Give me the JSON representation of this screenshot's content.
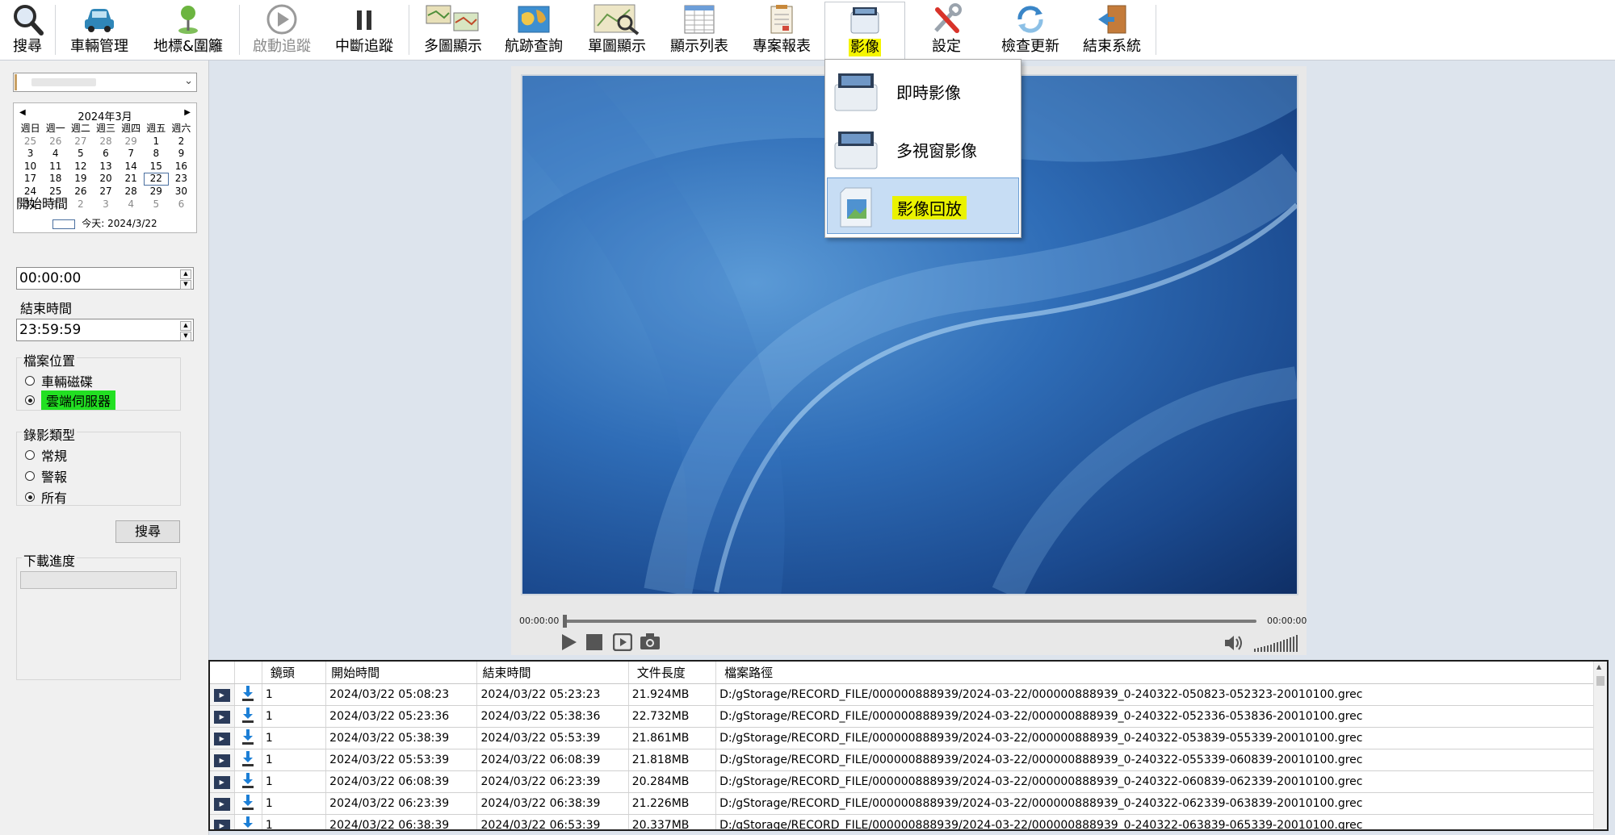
{
  "toolbar": {
    "items": [
      {
        "id": "search",
        "label": "搜尋"
      },
      {
        "id": "vehicle",
        "label": "車輛管理"
      },
      {
        "id": "landmark",
        "label": "地標&圍籬"
      },
      {
        "id": "start_track",
        "label": "啟動追蹤",
        "disabled": true
      },
      {
        "id": "stop_track",
        "label": "中斷追蹤"
      },
      {
        "id": "multi_map",
        "label": "多圖顯示"
      },
      {
        "id": "track_query",
        "label": "航跡查詢"
      },
      {
        "id": "single_map",
        "label": "單圖顯示"
      },
      {
        "id": "list",
        "label": "顯示列表"
      },
      {
        "id": "report",
        "label": "專案報表"
      },
      {
        "id": "video",
        "label": "影像",
        "active": true
      },
      {
        "id": "settings",
        "label": "設定"
      },
      {
        "id": "update",
        "label": "檢查更新"
      },
      {
        "id": "exit",
        "label": "結束系統"
      }
    ]
  },
  "video_menu": {
    "items": [
      {
        "label": "即時影像"
      },
      {
        "label": "多視窗影像"
      },
      {
        "label": "影像回放",
        "selected": true
      }
    ]
  },
  "left": {
    "calendar": {
      "month_label": "2024年3月",
      "weekdays": [
        "週日",
        "週一",
        "週二",
        "週三",
        "週四",
        "週五",
        "週六"
      ],
      "weeks": [
        [
          "25",
          "26",
          "27",
          "28",
          "29",
          "1",
          "2"
        ],
        [
          "3",
          "4",
          "5",
          "6",
          "7",
          "8",
          "9"
        ],
        [
          "10",
          "11",
          "12",
          "13",
          "14",
          "15",
          "16"
        ],
        [
          "17",
          "18",
          "19",
          "20",
          "21",
          "22",
          "23"
        ],
        [
          "24",
          "25",
          "26",
          "27",
          "28",
          "29",
          "30"
        ],
        [
          "31",
          "1",
          "2",
          "3",
          "4",
          "5",
          "6"
        ]
      ],
      "today_label": "今天: 2024/3/22"
    },
    "start_time_label": "開始時間",
    "start_time": "00:00:00",
    "end_time_label": "結束時間",
    "end_time": "23:59:59",
    "file_location": {
      "title": "檔案位置",
      "options": [
        "車輛磁碟",
        "雲端伺服器"
      ],
      "selected": 1
    },
    "record_type": {
      "title": "錄影類型",
      "options": [
        "常規",
        "警報",
        "所有"
      ],
      "selected": 2
    },
    "search_button": "搜尋",
    "download_progress": {
      "title": "下載進度",
      "progress": 0
    }
  },
  "player": {
    "time_current": "00:00:00",
    "time_total": "00:00:00"
  },
  "table": {
    "columns": [
      "",
      "",
      "鏡頭",
      "開始時間",
      "結束時間",
      "文件長度",
      "檔案路徑"
    ],
    "rows": [
      [
        "1",
        "2024/03/22 05:08:23",
        "2024/03/22 05:23:23",
        "21.924MB",
        "D:/gStorage/RECORD_FILE/000000888939/2024-03-22/000000888939_0-240322-050823-052323-20010100.grec"
      ],
      [
        "1",
        "2024/03/22 05:23:36",
        "2024/03/22 05:38:36",
        "22.732MB",
        "D:/gStorage/RECORD_FILE/000000888939/2024-03-22/000000888939_0-240322-052336-053836-20010100.grec"
      ],
      [
        "1",
        "2024/03/22 05:38:39",
        "2024/03/22 05:53:39",
        "21.861MB",
        "D:/gStorage/RECORD_FILE/000000888939/2024-03-22/000000888939_0-240322-053839-055339-20010100.grec"
      ],
      [
        "1",
        "2024/03/22 05:53:39",
        "2024/03/22 06:08:39",
        "21.818MB",
        "D:/gStorage/RECORD_FILE/000000888939/2024-03-22/000000888939_0-240322-055339-060839-20010100.grec"
      ],
      [
        "1",
        "2024/03/22 06:08:39",
        "2024/03/22 06:23:39",
        "20.284MB",
        "D:/gStorage/RECORD_FILE/000000888939/2024-03-22/000000888939_0-240322-060839-062339-20010100.grec"
      ],
      [
        "1",
        "2024/03/22 06:23:39",
        "2024/03/22 06:38:39",
        "21.226MB",
        "D:/gStorage/RECORD_FILE/000000888939/2024-03-22/000000888939_0-240322-062339-063839-20010100.grec"
      ],
      [
        "1",
        "2024/03/22 06:38:39",
        "2024/03/22 06:53:39",
        "20.337MB",
        "D:/gStorage/RECORD_FILE/000000888939/2024-03-22/000000888939_0-240322-063839-065339-20010100.grec"
      ]
    ]
  },
  "colors": {
    "active_highlight": "#f5f500",
    "radio_highlight": "#22e022",
    "menu_selected_bg": "#c7ddf4"
  }
}
